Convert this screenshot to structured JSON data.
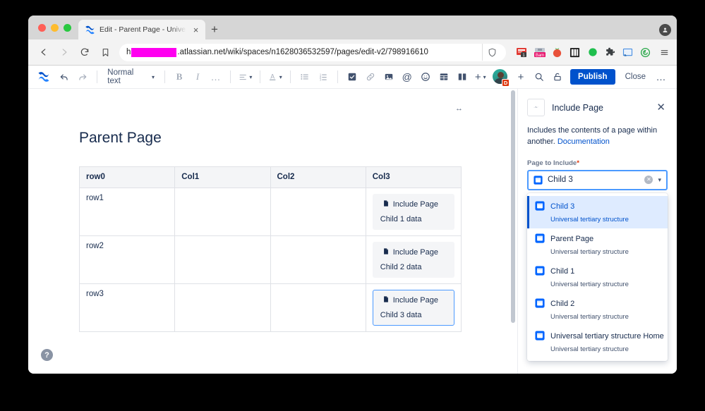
{
  "browser": {
    "tab": {
      "title": "Edit - Parent Page - Universal te",
      "favicon": "confluence-icon",
      "close_label": "×"
    },
    "new_tab_label": "+",
    "url": {
      "redacted": true,
      "suffix": ".atlassian.net/wiki/spaces/n1628036532597/pages/edit-v2/798916610"
    },
    "nav": {
      "back": "back-icon",
      "forward": "forward-icon",
      "reload": "reload-icon",
      "bookmark": "bookmark-icon",
      "shield": "shield-icon",
      "menu": "hamburger-menu-icon"
    },
    "extensions": [
      "news-extension-icon",
      "bam-extension-icon",
      "tomato-timer-icon",
      "grid-extension-icon",
      "green-dot-extension-icon",
      "puzzle-extensions-icon",
      "cast-icon",
      "spiral-extension-icon"
    ]
  },
  "editor": {
    "logo": "confluence-logo",
    "undo_label": "undo-icon",
    "redo_label": "redo-icon",
    "text_style": "Normal text",
    "bold_label": "B",
    "italic_label": "I",
    "more_formatting_label": "…",
    "align_label": "align-icon",
    "text_color_label": "A",
    "bullet_list_label": "bullet-list-icon",
    "number_list_label": "numbered-list-icon",
    "task_label": "task-checkbox-icon",
    "link_label": "link-icon",
    "image_label": "image-icon",
    "mention_label": "@",
    "emoji_label": "emoji-icon",
    "table_label": "table-icon",
    "layout_label": "layout-icon",
    "insert_label": "+",
    "add_label": "+",
    "search_label": "search-icon",
    "restrictions_label": "lock-icon",
    "publish_label": "Publish",
    "close_label": "Close",
    "more_label": "…",
    "avatar_badge": "D"
  },
  "page": {
    "title": "Parent Page",
    "resize_handle": "↔",
    "help_label": "?"
  },
  "table": {
    "headers": [
      "row0",
      "Col1",
      "Col2",
      "Col3"
    ],
    "rows": [
      {
        "label": "row1",
        "c1": "",
        "c2": "",
        "macro": {
          "name": "Include Page",
          "body": "Child 1 data",
          "selected": false
        }
      },
      {
        "label": "row2",
        "c1": "",
        "c2": "",
        "macro": {
          "name": "Include Page",
          "body": "Child 2 data",
          "selected": false
        }
      },
      {
        "label": "row3",
        "c1": "",
        "c2": "",
        "macro": {
          "name": "Include Page",
          "body": "Child 3 data",
          "selected": true
        }
      }
    ]
  },
  "panel": {
    "icon": "include-page-macro-icon",
    "title": "Include Page",
    "close_label": "✕",
    "description_text": "Includes the contents of a page within another. ",
    "description_link": "Documentation",
    "field_label": "Page to Include",
    "required_mark": "*",
    "selected_value": "Child 3",
    "clear_label": "✕",
    "caret_label": "⌄",
    "options": [
      {
        "title": "Child 3",
        "subtitle": "Universal tertiary structure",
        "active": true
      },
      {
        "title": "Parent Page",
        "subtitle": "Universal tertiary structure",
        "active": false
      },
      {
        "title": "Child 1",
        "subtitle": "Universal tertiary structure",
        "active": false
      },
      {
        "title": "Child 2",
        "subtitle": "Universal tertiary structure",
        "active": false
      },
      {
        "title": "Universal tertiary structure Home",
        "subtitle": "Universal tertiary structure",
        "active": false
      }
    ]
  },
  "colors": {
    "accent": "#0052cc",
    "selection": "#deebff",
    "focus_border": "#4c9aff",
    "text": "#172b4d",
    "redaction": "#ff00f0",
    "badge": "#de350b"
  }
}
